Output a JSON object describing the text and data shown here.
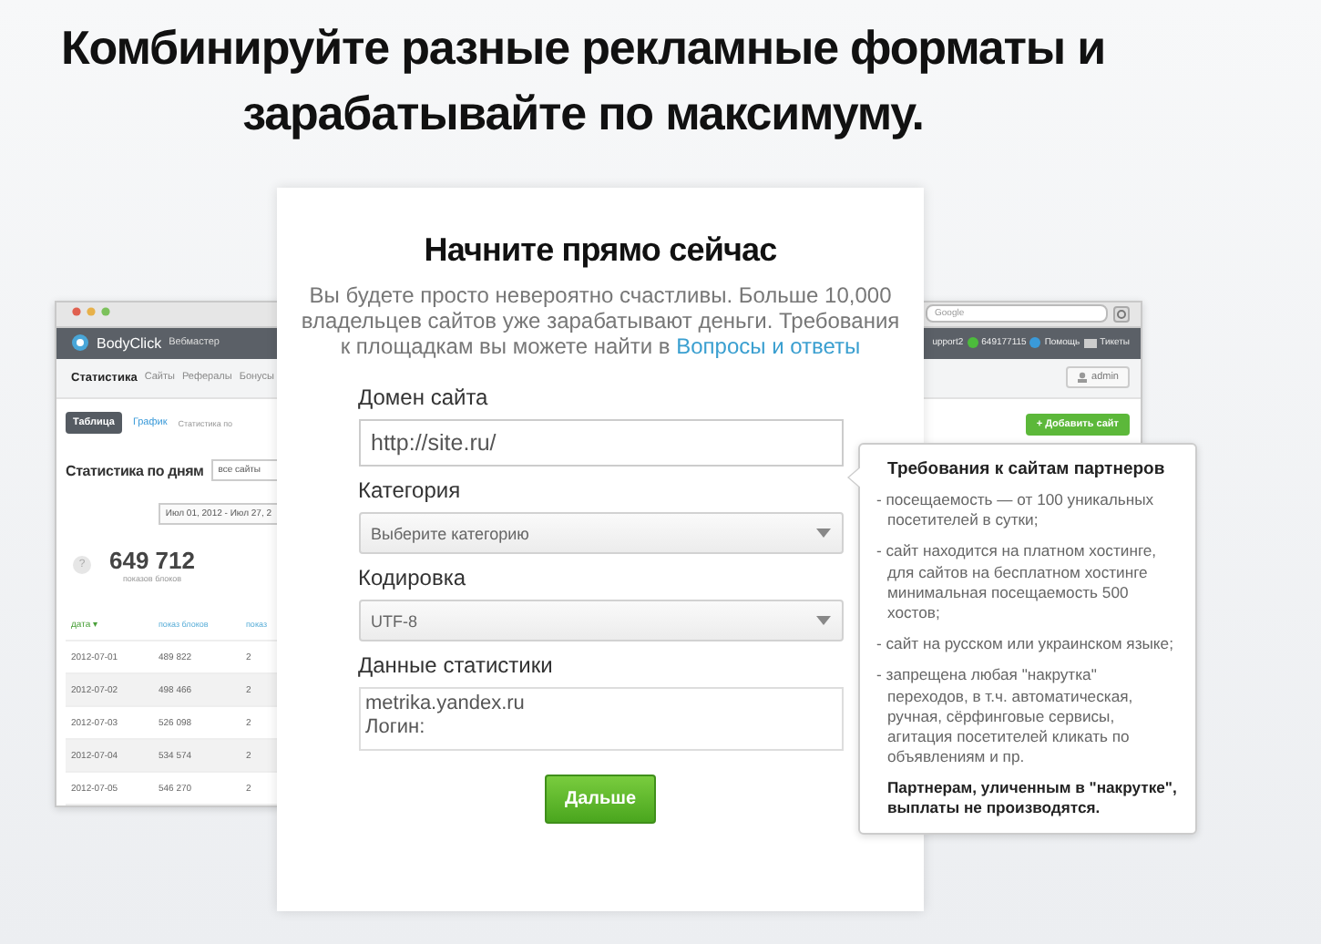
{
  "headline": {
    "lines": [
      "Комбинируйте разные рекламные форматы и",
      "зарабатывайте по максимуму."
    ]
  },
  "background_app": {
    "brand": "BodyClick",
    "role": "Вебмастер",
    "search_placeholder": "Google",
    "header_right": [
      {
        "kind": "text",
        "text": "upport2"
      },
      {
        "kind": "dot",
        "text": "649177115",
        "color": "#4cbb3c"
      },
      {
        "kind": "dot",
        "text": "Помощь",
        "color": "#3a9ad9"
      },
      {
        "kind": "mail",
        "text": "Тикеты"
      }
    ],
    "nav": [
      {
        "label": "Статистика",
        "selected": true
      },
      {
        "label": "Сайты",
        "selected": false
      },
      {
        "label": "Рефералы",
        "selected": false
      },
      {
        "label": "Бонусы",
        "selected": false
      }
    ],
    "user": "admin",
    "add_button": "+ Добавить сайт",
    "view_tabs": [
      {
        "label": "Таблица",
        "selected": true
      },
      {
        "label": "График",
        "selected": false
      },
      {
        "label": "Статистика по",
        "selected": false
      }
    ],
    "stats_title": "Статистика по дням",
    "site_filter": "все сайты",
    "date_range": "Июл 01, 2012 - Июл 27, 2",
    "help": "?",
    "total": "649 712",
    "total_caption": "показов блоков",
    "columns": [
      "дата ▾",
      "показ блоков",
      "показ"
    ],
    "rows": [
      [
        "2012-07-01",
        "489 822",
        "2"
      ],
      [
        "2012-07-02",
        "498 466",
        "2"
      ],
      [
        "2012-07-03",
        "526 098",
        "2"
      ],
      [
        "2012-07-04",
        "534 574",
        "2"
      ],
      [
        "2012-07-05",
        "546 270",
        "2"
      ]
    ]
  },
  "signup": {
    "title": "Начните прямо сейчас",
    "intro": "Вы будете просто невероятно счастливы. Больше 10,000 владельцев сайтов уже зарабатывают деньги. Требования к площадкам вы можете найти в",
    "link": "Вопросы и ответы",
    "fields": [
      {
        "kind": "input",
        "label": "Домен сайта",
        "value": "http://site.ru/"
      },
      {
        "kind": "select",
        "label": "Категория",
        "value": "Выберите категорию"
      },
      {
        "kind": "select",
        "label": "Кодировка",
        "value": "UTF-8"
      },
      {
        "kind": "textarea",
        "label": "Данные статистики",
        "value": "metrika.yandex.ru\nЛогин:"
      }
    ],
    "button": "Дальше"
  },
  "tooltip": {
    "title": "Требования к сайтам партнеров",
    "items": [
      "- посещаемость — от 100 уникальных посетителей в сутки;",
      "- сайт находится на платном хостинге, для сайтов на бесплатном хостинге минимальная посещаемость 500 хостов;",
      "- сайт на русском или украинском языке;",
      "- запрещена любая \"накрутка\" переходов, в т.ч. автоматическая, ручная, сёрфинговые сервисы, агитация посетителей кликать по объявлениям и пр."
    ],
    "note": "Партнерам, уличенным в \"накрутке\", выплаты не производятся."
  }
}
